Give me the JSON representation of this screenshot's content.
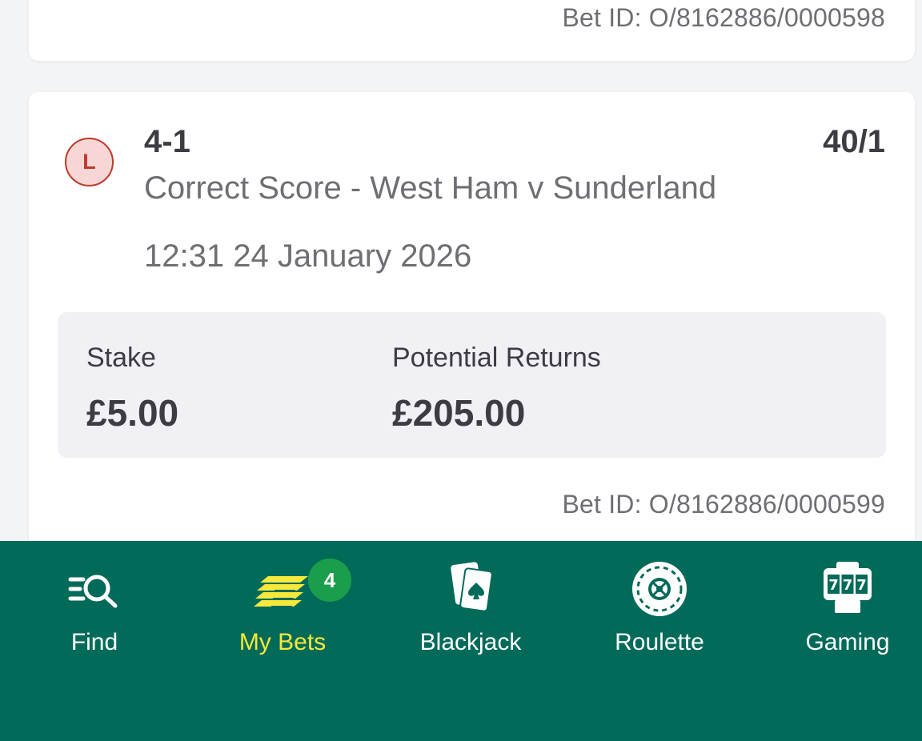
{
  "previous_bet": {
    "bet_id": "Bet ID: O/8162886/0000598"
  },
  "bet": {
    "result_letter": "L",
    "selection": "4-1",
    "odds": "40/1",
    "market": "Correct Score - West Ham v Sunderland",
    "placed_time": "12:31 24 January 2026",
    "stake_label": "Stake",
    "stake_value": "£5.00",
    "returns_label": "Potential Returns",
    "returns_value": "£205.00",
    "bet_id": "Bet ID: O/8162886/0000599"
  },
  "nav": {
    "items": [
      {
        "label": "Find",
        "icon": "find-icon"
      },
      {
        "label": "My Bets",
        "icon": "my-bets-icon",
        "badge": "4",
        "active": true
      },
      {
        "label": "Blackjack",
        "icon": "blackjack-icon"
      },
      {
        "label": "Roulette",
        "icon": "roulette-icon"
      },
      {
        "label": "Gaming",
        "icon": "slot-machine-icon"
      }
    ]
  },
  "colors": {
    "nav_background": "#026a59",
    "active_nav": "#f6e93b",
    "badge": "#1b9e4b",
    "loss": "#c0392b"
  }
}
